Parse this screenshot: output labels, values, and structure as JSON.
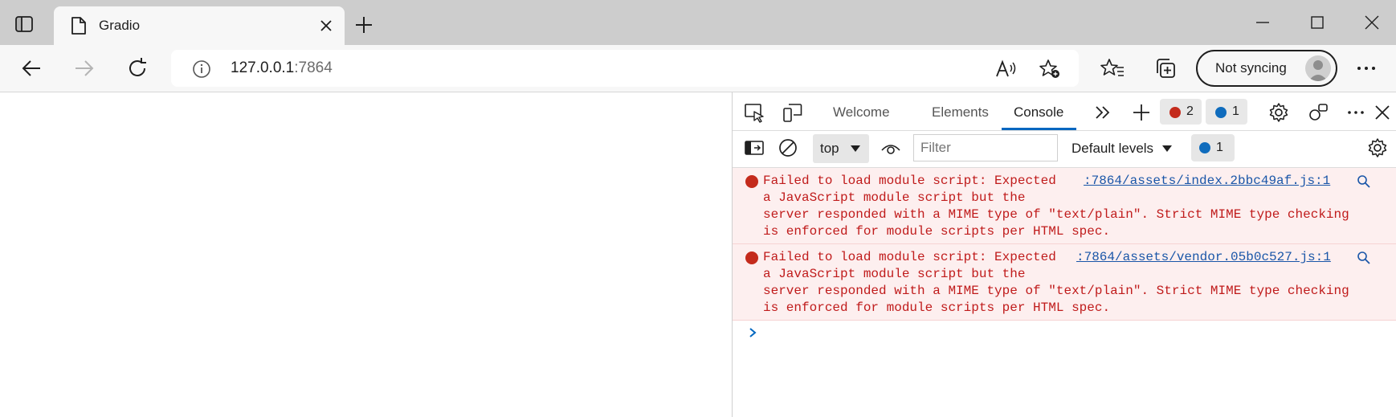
{
  "browser": {
    "tab": {
      "title": "Gradio"
    },
    "omnibox": {
      "host": "127.0.0.1",
      "port": ":7864"
    },
    "profile": {
      "sync_label": "Not syncing"
    }
  },
  "devtools": {
    "tabs": [
      {
        "label": "Welcome",
        "active": false
      },
      {
        "label": "Elements",
        "active": false
      },
      {
        "label": "Console",
        "active": true
      }
    ],
    "error_count": "2",
    "message_count": "1",
    "context": "top",
    "filter_placeholder": "Filter",
    "levels_label": "Default levels",
    "filter_message_count": "1",
    "console_messages": [
      {
        "line1": "Failed to load module script: Expected",
        "line2": "a JavaScript module script but the",
        "line3": "server responded with a MIME type of \"text/plain\". Strict MIME type checking",
        "line4": "is enforced for module scripts per HTML spec.",
        "source": ":7864/assets/index.2bbc49af.js:1"
      },
      {
        "line1": "Failed to load module script: Expected",
        "line2": "a JavaScript module script but the",
        "line3": "server responded with a MIME type of \"text/plain\". Strict MIME type checking",
        "line4": "is enforced for module scripts per HTML spec.",
        "source": ":7864/assets/vendor.05b0c527.js:1"
      }
    ]
  },
  "colors": {
    "error_text": "#c01b1b",
    "error_bg": "#fdefef",
    "link": "#1a56a8",
    "accent": "#0067c0"
  }
}
